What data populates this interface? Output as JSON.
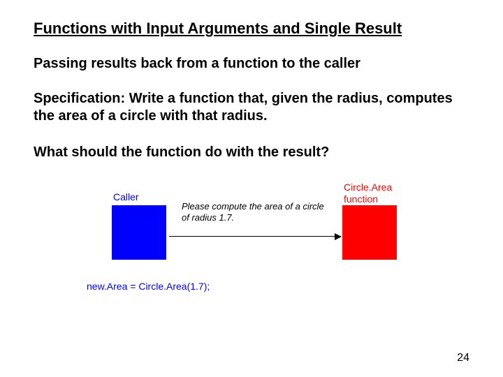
{
  "title": "Functions with Input Arguments and Single Result",
  "subtitle": "Passing results back from a function to the caller",
  "spec": "Specification: Write a function that, given the radius, computes the area of a circle with that radius.",
  "question": "What should the function do with the result?",
  "diagram": {
    "caller_label": "Caller",
    "func_label": "Circle.Area\nfunction",
    "message": "Please compute the area of a circle of radius 1.7.",
    "code": "new.Area = Circle.Area(1.7);"
  },
  "page_number": "24"
}
